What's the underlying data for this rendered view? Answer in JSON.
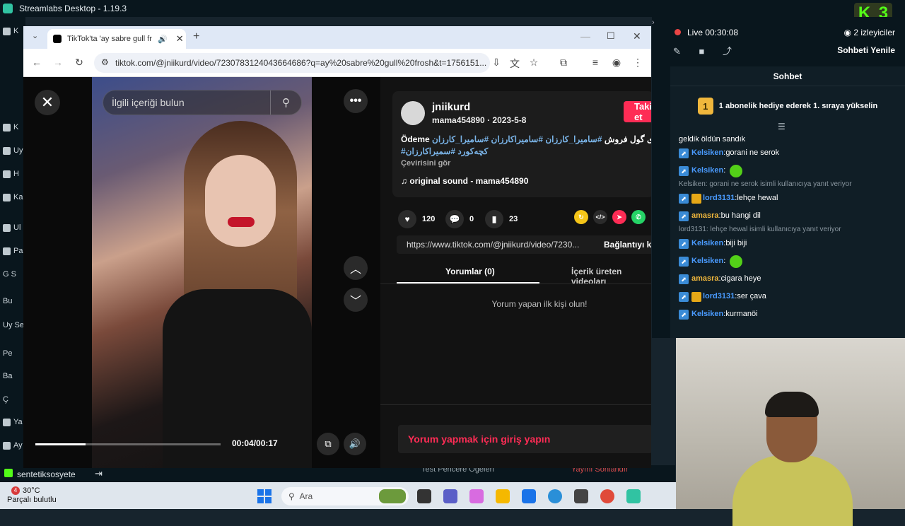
{
  "streamlabs": {
    "title": "Streamlabs Desktop - 1.19.3",
    "k3_label": "K3"
  },
  "sidebar": {
    "items": [
      {
        "label": "K"
      },
      {
        "label": "Uy"
      },
      {
        "label": "H"
      },
      {
        "label": "Ka"
      },
      {
        "label": "Ul"
      },
      {
        "label": "Pa"
      },
      {
        "label": "G S"
      },
      {
        "label": "Bu"
      },
      {
        "label": "Uy Se"
      },
      {
        "label": "Pe"
      },
      {
        "label": "Ba"
      },
      {
        "label": "Ç"
      },
      {
        "label": "Ya"
      },
      {
        "label": "Ay"
      }
    ],
    "account": "sentetiksosyete"
  },
  "bottombar": {
    "test_label": "Test Pencere Öğeleri",
    "end_label": "Yayını Sonlandır"
  },
  "browser": {
    "tab_title": "TikTok'ta 'ay sabre gull frosh",
    "url": "tiktok.com/@jniikurd/video/7230783124043664686?q=ay%20sabre%20gull%20frosh&t=1756151..."
  },
  "tiktok": {
    "search_placeholder": "İlgili içeriği bulun",
    "timecode": "00:04/00:17",
    "progress": 0.27,
    "username": "jniikurd",
    "user_meta": "mama454890 · 2023-5-8",
    "follow_label": "Takip et",
    "description_text": "Ödeme سەبری گول فروش",
    "description_tags_1": "#سامیرا_کارزان #سامیراکارزان #سامیرا_کارزان",
    "description_tags_2": "#کچەکورد #سمیراکارزان",
    "translate_label": "Çevirisini gör",
    "sound_label": "original sound - mama454890",
    "likes": "120",
    "comments": "0",
    "saves": "23",
    "share_link": "https://www.tiktok.com/@jniikurd/video/7230...",
    "copy_link_label": "Bağlantıyı kopyala",
    "tab_comments": "Yorumlar (0)",
    "tab_creator": "İçerik üreten videoları",
    "empty_comments": "Yorum yapan ilk kişi olun!",
    "login_prompt": "Yorum yapmak için giriş yapın"
  },
  "chat": {
    "live_label": "Live",
    "live_time": "00:30:08",
    "viewers": "2 izleyiciler",
    "refresh_label": "Sohbeti Yenile",
    "header": "Sohbet",
    "gift_rank": "1",
    "gift_text": "1 abonelik hediye ederek 1. sıraya yükselin",
    "messages": [
      {
        "type": "text",
        "text": "geldik öldün sandık"
      },
      {
        "type": "msg",
        "user": "Kelsiken",
        "user_color": "#4a9bff",
        "text": "gorani ne serok"
      },
      {
        "type": "emote",
        "user": "Kelsiken",
        "user_color": "#4a9bff",
        "text": ""
      },
      {
        "type": "reply",
        "text": "Kelsiken: gorani ne serok isimli kullanıcıya yanıt veriyor"
      },
      {
        "type": "msg",
        "user": "lord3131",
        "user_color": "#4a9bff",
        "crown": true,
        "text": "lehçe hewal"
      },
      {
        "type": "msg",
        "user": "amasra",
        "user_color": "#f0b73c",
        "text": "bu hangi dil"
      },
      {
        "type": "reply",
        "text": "lord3131: lehçe hewal isimli kullanıcıya yanıt veriyor"
      },
      {
        "type": "msg",
        "user": "Kelsiken",
        "user_color": "#4a9bff",
        "text": "biji biji"
      },
      {
        "type": "emote",
        "user": "Kelsiken",
        "user_color": "#4a9bff",
        "text": ""
      },
      {
        "type": "msg",
        "user": "amasra",
        "user_color": "#f0b73c",
        "text": "cigara heye"
      },
      {
        "type": "msg",
        "user": "lord3131",
        "user_color": "#4a9bff",
        "crown": true,
        "text": "ser çava"
      },
      {
        "type": "msg",
        "user": "Kelsiken",
        "user_color": "#4a9bff",
        "text": "kurmanöi"
      }
    ]
  },
  "taskbar": {
    "temp": "30°C",
    "weather": "Parçalı bulutlu",
    "weather_badge": "4",
    "search_placeholder": "Ara"
  }
}
